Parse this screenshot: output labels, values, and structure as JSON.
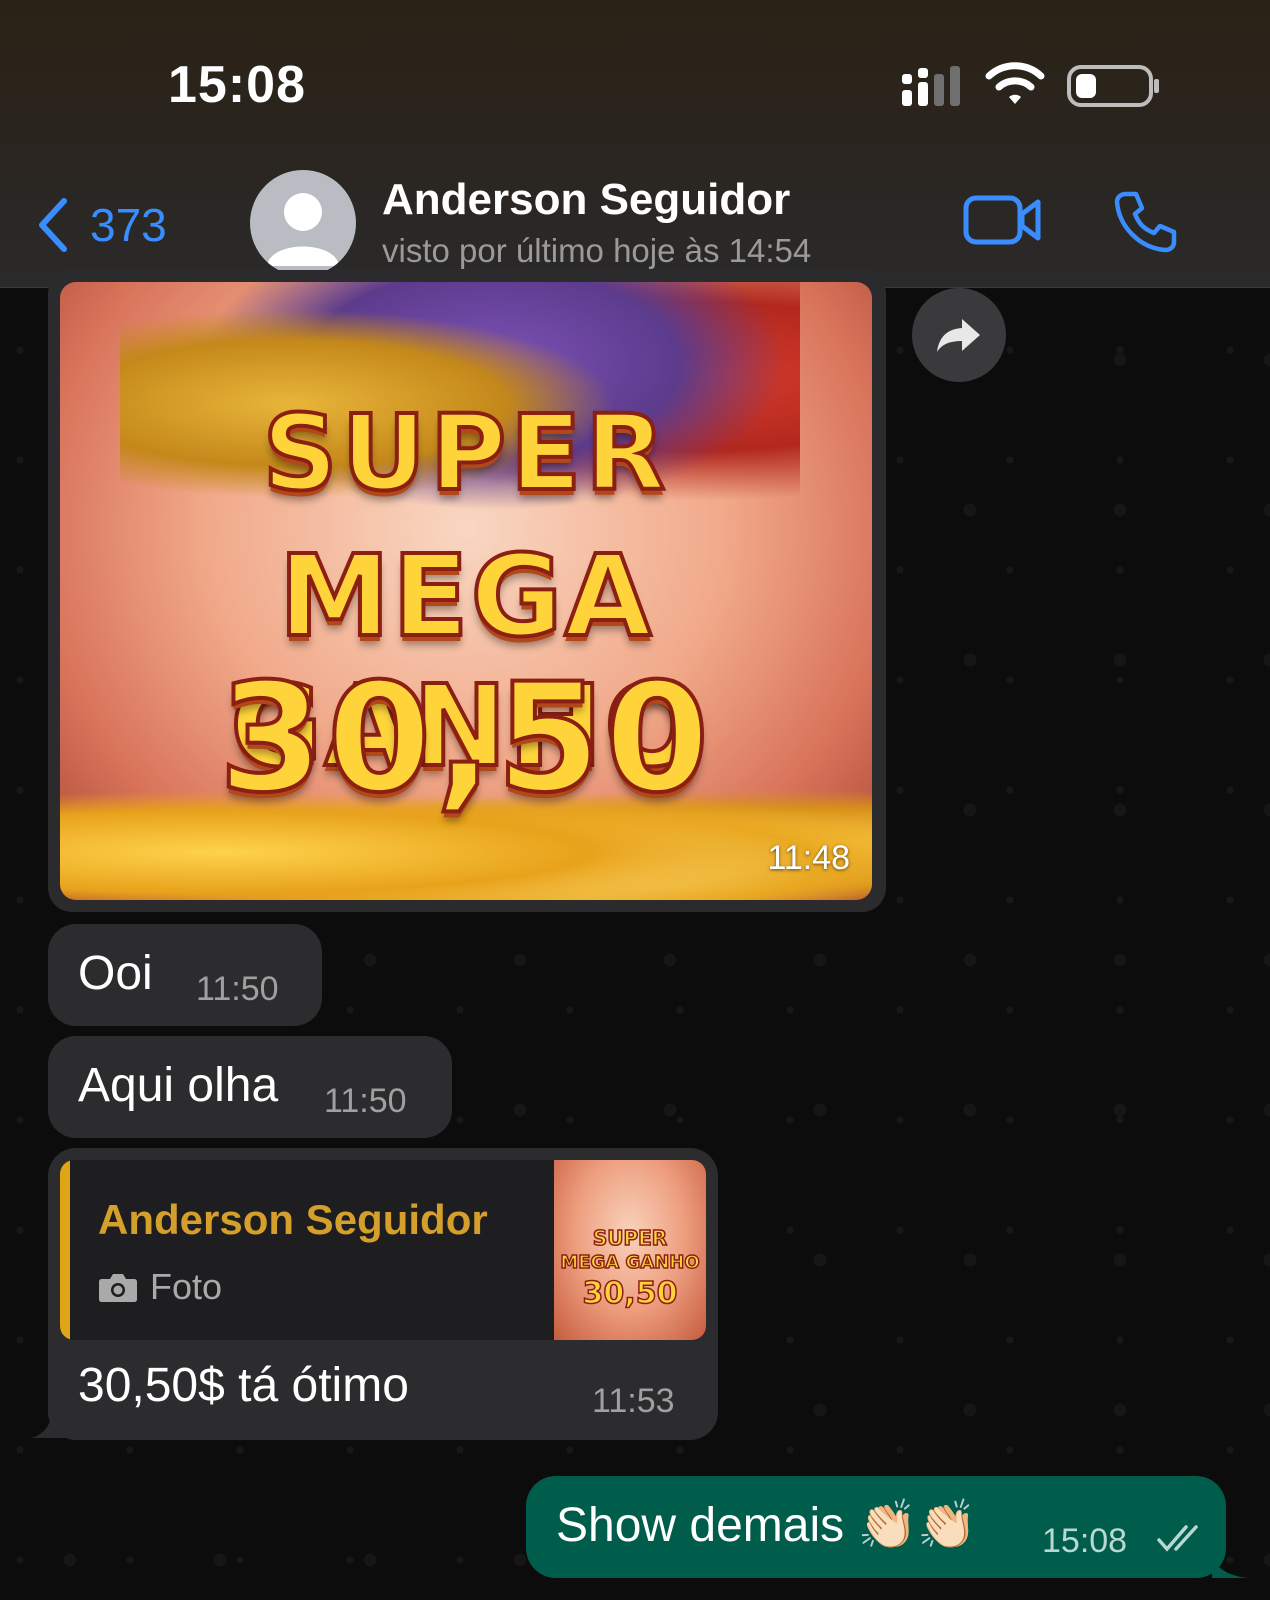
{
  "status_bar": {
    "time": "15:08"
  },
  "header": {
    "back_count": "373",
    "contact_name": "Anderson Seguidor",
    "contact_status": "visto por último hoje às 14:54"
  },
  "messages": {
    "image": {
      "lines": [
        "SUPER",
        "MEGA GANHO",
        "30,50"
      ],
      "time": "11:48"
    },
    "msg1": {
      "text": "Ooi",
      "time": "11:50"
    },
    "msg2": {
      "text": "Aqui olha",
      "time": "11:50"
    },
    "reply": {
      "quoted_name": "Anderson Seguidor",
      "quoted_kind": "Foto",
      "thumb_lines": [
        "SUPER",
        "MEGA GANHO",
        "30,50"
      ],
      "text": "30,50$ tá ótimo",
      "time": "11:53"
    },
    "outgoing": {
      "text": "Show demais 👏🏻👏🏻",
      "time": "15:08"
    }
  },
  "colors": {
    "accent_blue": "#3a8dff",
    "incoming_bubble": "#2c2c2e",
    "outgoing_bubble": "#005c4b",
    "quote_name": "#d59f2b"
  }
}
